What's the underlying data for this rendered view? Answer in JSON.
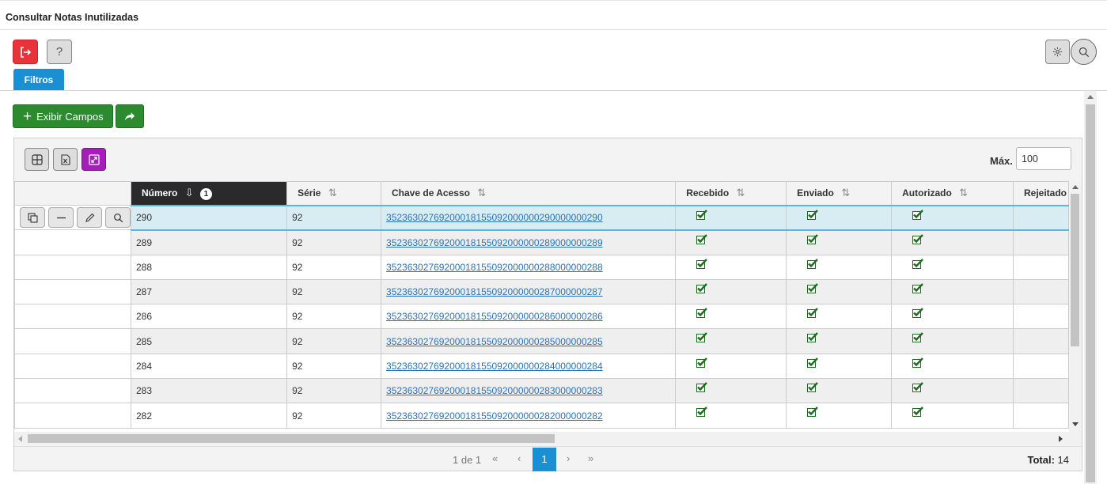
{
  "window": {
    "title": "Consultar Notas Inutilizadas"
  },
  "toolbar": {
    "exit_icon": "exit-icon",
    "help_label": "?",
    "settings_icon": "gear-icon",
    "search_icon": "search-icon",
    "filtros_label": "Filtros"
  },
  "actions": {
    "exibir_label": "Exibir Campos",
    "share_icon": "share-icon"
  },
  "grid": {
    "max_label": "Máx.",
    "max_value": "100",
    "columns": [
      {
        "label": "Número",
        "sorted": true,
        "sort_badge": "1"
      },
      {
        "label": "Série"
      },
      {
        "label": "Chave de Acesso"
      },
      {
        "label": "Recebido"
      },
      {
        "label": "Enviado"
      },
      {
        "label": "Autorizado"
      },
      {
        "label": "Rejeitado"
      }
    ],
    "rows": [
      {
        "numero": "290",
        "serie": "92",
        "chave": "35236302769200018155092000000290000000290",
        "recebido": true,
        "enviado": true,
        "autorizado": true
      },
      {
        "numero": "289",
        "serie": "92",
        "chave": "35236302769200018155092000000289000000289",
        "recebido": true,
        "enviado": true,
        "autorizado": true
      },
      {
        "numero": "288",
        "serie": "92",
        "chave": "35236302769200018155092000000288000000288",
        "recebido": true,
        "enviado": true,
        "autorizado": true
      },
      {
        "numero": "287",
        "serie": "92",
        "chave": "35236302769200018155092000000287000000287",
        "recebido": true,
        "enviado": true,
        "autorizado": true
      },
      {
        "numero": "286",
        "serie": "92",
        "chave": "35236302769200018155092000000286000000286",
        "recebido": true,
        "enviado": true,
        "autorizado": true
      },
      {
        "numero": "285",
        "serie": "92",
        "chave": "35236302769200018155092000000285000000285",
        "recebido": true,
        "enviado": true,
        "autorizado": true
      },
      {
        "numero": "284",
        "serie": "92",
        "chave": "35236302769200018155092000000284000000284",
        "recebido": true,
        "enviado": true,
        "autorizado": true
      },
      {
        "numero": "283",
        "serie": "92",
        "chave": "35236302769200018155092000000283000000283",
        "recebido": true,
        "enviado": true,
        "autorizado": true
      },
      {
        "numero": "282",
        "serie": "92",
        "chave": "35236302769200018155092000000282000000282",
        "recebido": true,
        "enviado": true,
        "autorizado": true
      }
    ]
  },
  "pager": {
    "info": "1 de 1",
    "first": "«",
    "prev": "‹",
    "current_page": "1",
    "next": "›",
    "last": "»",
    "total_label": "Total:",
    "total_value": "14"
  },
  "colors": {
    "primary": "#1b8fd3",
    "success": "#2c8b2f",
    "danger": "#e8333a",
    "purple": "#a31fb8",
    "sorted_header": "#2a2a2d"
  }
}
